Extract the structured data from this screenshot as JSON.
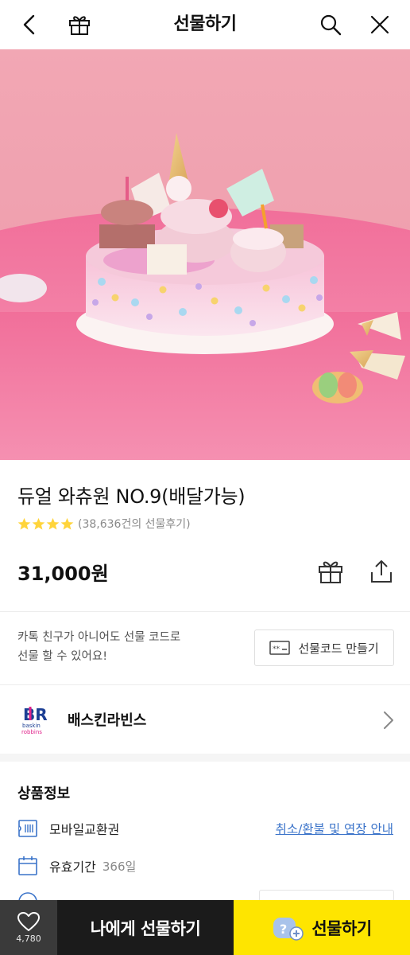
{
  "header": {
    "title": "선물하기",
    "icons": [
      "back-icon",
      "gift-icon",
      "search-icon",
      "close-icon"
    ]
  },
  "hero": {
    "subject": "cake-image"
  },
  "product": {
    "title": "듀얼 와츄원 NO.9(배달가능)",
    "rating_stars": 4,
    "review_text": "(38,636건의 선물후기)",
    "price": "31,000원"
  },
  "gift_code": {
    "text_line1": "카톡 친구가 아니어도 선물 코드로",
    "text_line2": "선물 할 수 있어요!",
    "button_label": "선물코드 만들기"
  },
  "brand": {
    "name": "배스킨라빈스",
    "logo_text": "BR"
  },
  "info": {
    "title": "상품정보",
    "rows": [
      {
        "label": "모바일교환권",
        "value": ""
      },
      {
        "label": "유효기간",
        "value": "366일"
      }
    ],
    "link": "취소/환불 및 연장 안내"
  },
  "bottom_bar": {
    "like_count": "4,780",
    "self_gift_label": "나에게 선물하기",
    "gift_label": "선물하기"
  },
  "colors": {
    "accent_yellow": "#fee500",
    "star_yellow": "#ffd43b",
    "link_blue": "#3a73c9",
    "dark_button": "#1b1b1b",
    "hero_pink": "#f0a0b2"
  }
}
